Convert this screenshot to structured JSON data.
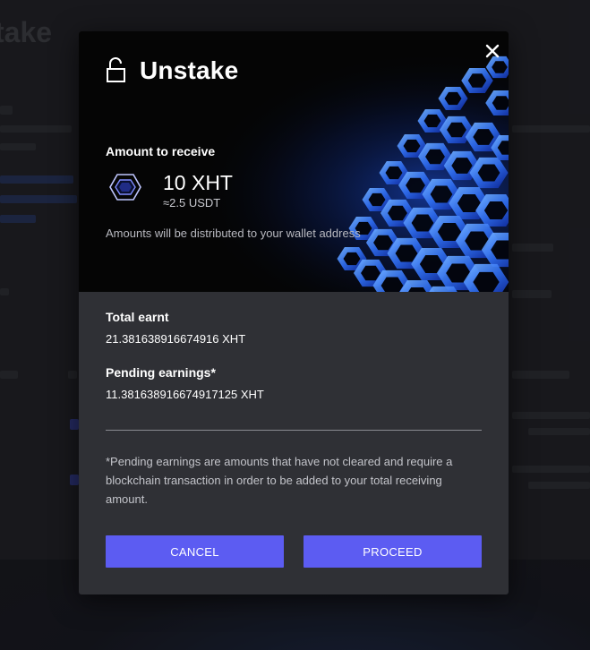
{
  "background_page": {
    "title": "take"
  },
  "modal": {
    "title": "Unstake",
    "icons": {
      "title_icon": "unlock-icon",
      "close_icon": "close-icon",
      "coin_icon": "xht-token-icon"
    },
    "amount_to_receive": {
      "label": "Amount to receive",
      "amount": "10 XHT",
      "fiat_equivalent": "≈2.5 USDT"
    },
    "distribution_note": "Amounts will be distributed to your wallet address",
    "total_earnt": {
      "label": "Total earnt",
      "value": "21.381638916674916 XHT"
    },
    "pending_earnings": {
      "label": "Pending earnings*",
      "value": "11.381638916674917125 XHT"
    },
    "footnote": "*Pending earnings are amounts that have not cleared and require a blockchain transaction in order to be added to your total receiving amount.",
    "buttons": {
      "cancel": "CANCEL",
      "proceed": "PROCEED"
    }
  },
  "colors": {
    "accent_button": "#5c5cf2",
    "modal_body": "#2f3035",
    "hero_background": "#050505",
    "hero_glow": "#2f7bff"
  }
}
